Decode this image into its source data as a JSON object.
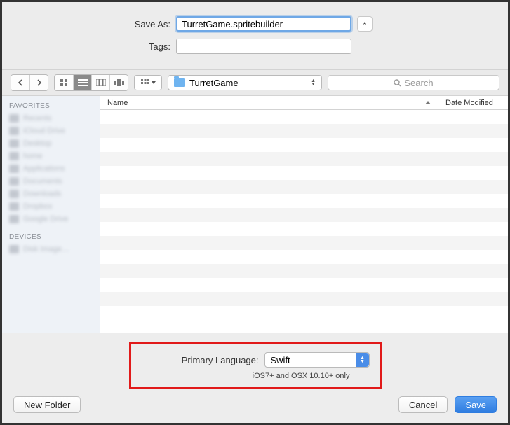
{
  "form": {
    "saveAsLabel": "Save As:",
    "saveAsValue": "TurretGame.spritebuilder",
    "tagsLabel": "Tags:",
    "tagsValue": ""
  },
  "toolbar": {
    "pathFolder": "TurretGame",
    "searchPlaceholder": "Search"
  },
  "sidebar": {
    "section1": "Favorites",
    "items": [
      "Recents",
      "iCloud Drive",
      "Desktop",
      "home",
      "Applications",
      "Documents",
      "Downloads",
      "Dropbox",
      "Google Drive"
    ],
    "section2": "Devices"
  },
  "fileHeader": {
    "name": "Name",
    "dateModified": "Date Modified"
  },
  "lang": {
    "label": "Primary Language:",
    "value": "Swift",
    "note": "iOS7+ and OSX 10.10+ only"
  },
  "buttons": {
    "newFolder": "New Folder",
    "cancel": "Cancel",
    "save": "Save"
  }
}
